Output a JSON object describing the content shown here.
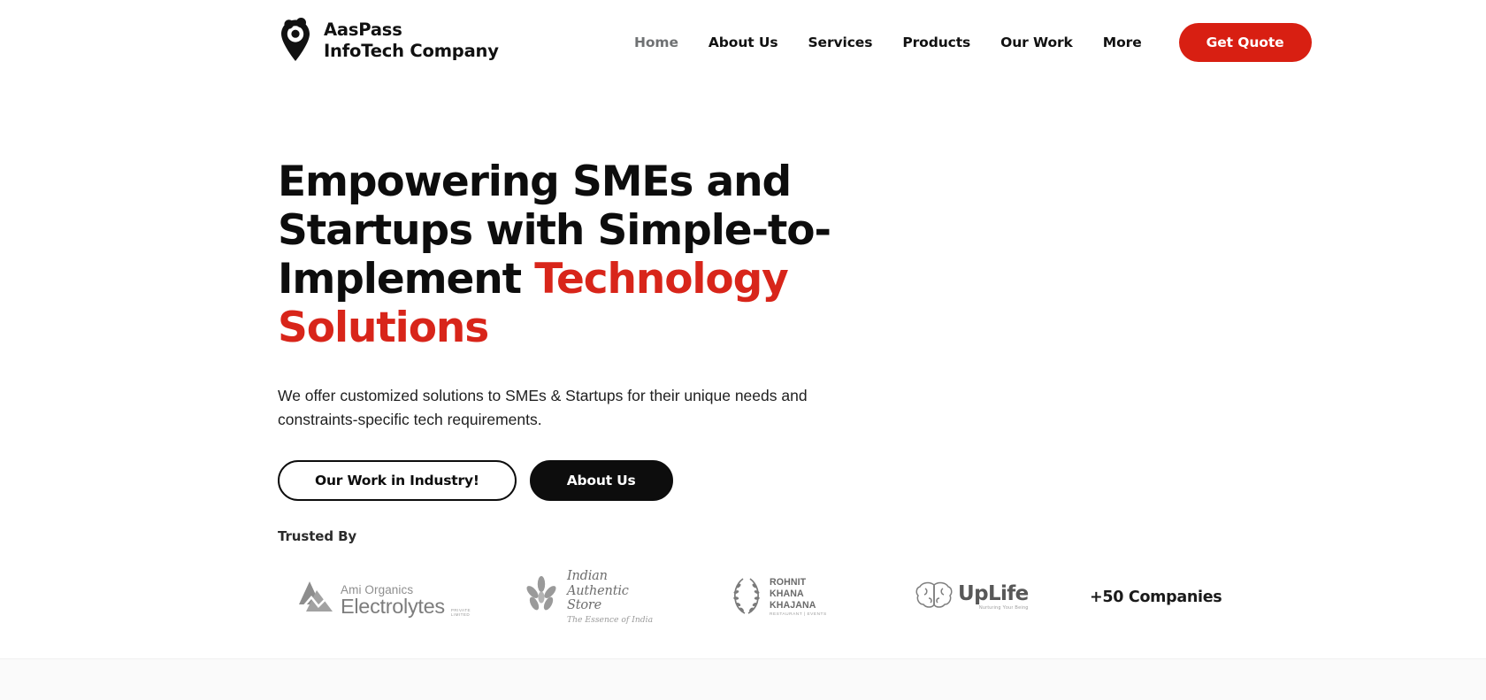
{
  "brand": {
    "name": "AasPass\nInfoTech Company",
    "logo_icon": "location-pin-people-icon",
    "accent_color": "#d81f12"
  },
  "nav": {
    "items": [
      {
        "label": "Home",
        "active": true
      },
      {
        "label": "About Us",
        "active": false
      },
      {
        "label": "Services",
        "active": false
      },
      {
        "label": "Products",
        "active": false
      },
      {
        "label": "Our Work",
        "active": false
      },
      {
        "label": "More",
        "active": false
      }
    ],
    "cta": {
      "label": "Get Quote",
      "bg": "#d81f12",
      "color": "#ffffff"
    }
  },
  "hero": {
    "headline_part1": "Empowering SMEs and Startups with Simple-to-Implement ",
    "headline_accent": "Technology Solutions",
    "accent_color": "#d8251a",
    "subcopy": "We offer customized solutions to SMEs & Startups for their unique needs and constraints-specific tech requirements.",
    "buttons": {
      "primary_outline": "Our Work in Industry!",
      "secondary_solid": "About Us"
    }
  },
  "trusted": {
    "label": "Trusted By",
    "logos": [
      {
        "name": "ami-organics-electrolytes",
        "top": "Ami Organics",
        "main": "Electrolytes",
        "sub": "PRIVATE LIMITED"
      },
      {
        "name": "indian-authentic-store",
        "main": "Indian Authentic Store",
        "sub": "The Essence of India"
      },
      {
        "name": "rohnit-khana-khajana",
        "line1": "ROHNIT",
        "line2": "KHANA",
        "line3": "KHAJANA",
        "sub": "RESTAURANT | EVENTS"
      },
      {
        "name": "uplife",
        "main": "UpLife",
        "sub": "Nurturing Your Being"
      }
    ],
    "companies_count": "+50 Companies"
  }
}
